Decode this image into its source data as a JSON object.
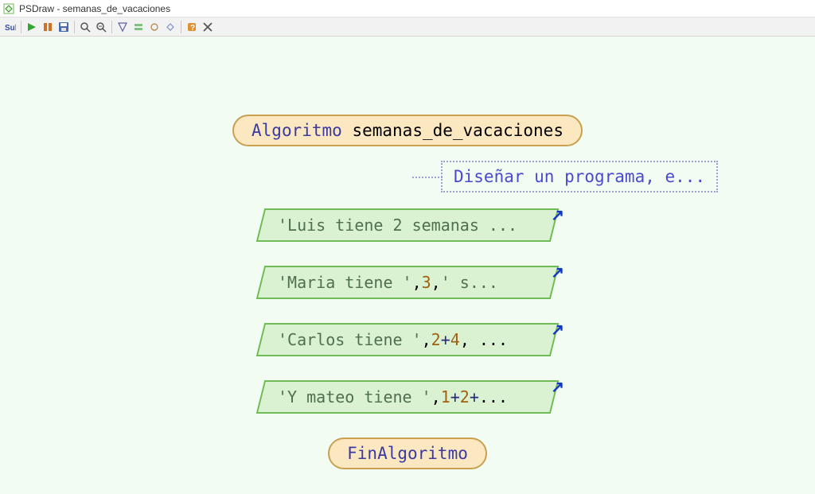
{
  "window": {
    "title": "PSDraw - semanas_de_vacaciones"
  },
  "toolbar": {
    "icons": [
      "sub",
      "run",
      "step",
      "save",
      "sep",
      "zoom-in",
      "zoom-out",
      "sep",
      "layout1",
      "layout2",
      "layout3",
      "layout4",
      "sep",
      "help",
      "close"
    ]
  },
  "diagram": {
    "start_keyword": "Algoritmo",
    "start_name": "semanas_de_vacaciones",
    "end_label": "FinAlgoritmo",
    "comment_text": "Diseñar un programa, e...",
    "outputs": [
      {
        "segments": [
          {
            "t": "str",
            "v": "'Luis tiene 2 semanas ..."
          }
        ]
      },
      {
        "segments": [
          {
            "t": "str",
            "v": "'Maria tiene '"
          },
          {
            "t": "txt",
            "v": ", "
          },
          {
            "t": "num",
            "v": "3"
          },
          {
            "t": "txt",
            "v": ", "
          },
          {
            "t": "str",
            "v": "' s..."
          }
        ]
      },
      {
        "segments": [
          {
            "t": "str",
            "v": "'Carlos tiene '"
          },
          {
            "t": "txt",
            "v": ", "
          },
          {
            "t": "num",
            "v": "2"
          },
          {
            "t": "op",
            "v": "+"
          },
          {
            "t": "num",
            "v": "4"
          },
          {
            "t": "txt",
            "v": ", ..."
          }
        ]
      },
      {
        "segments": [
          {
            "t": "str",
            "v": "'Y mateo tiene '"
          },
          {
            "t": "txt",
            "v": ", "
          },
          {
            "t": "num",
            "v": "1"
          },
          {
            "t": "op",
            "v": "+"
          },
          {
            "t": "num",
            "v": "2"
          },
          {
            "t": "op",
            "v": "+"
          },
          {
            "t": "txt",
            "v": "..."
          }
        ]
      }
    ]
  }
}
